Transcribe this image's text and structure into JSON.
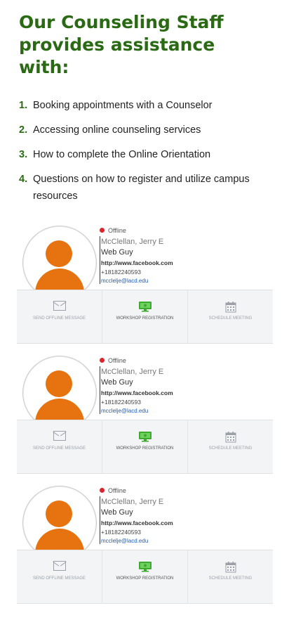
{
  "heading": {
    "line1": "Our Counseling Staff",
    "line2": "provides assistance",
    "line3": "with:"
  },
  "services": [
    {
      "number": "1.",
      "text": "Booking appointments with a Counselor"
    },
    {
      "number": "2.",
      "text": "Accessing online counseling services"
    },
    {
      "number": "3.",
      "text": "How to complete the Online Orientation"
    },
    {
      "number": "4.",
      "text": "Questions on how to register and utilize campus resources"
    }
  ],
  "colors": {
    "heading": "#2b6a14",
    "avatar": "#e6730f",
    "offline_dot": "#d8262b",
    "workshop_icon": "#3cab2d",
    "email_link": "#1b5eb5"
  },
  "cards": [
    {
      "status": "Offline",
      "name": "McClellan, Jerry E",
      "title": "Web Guy",
      "url": "http://www.facebook.com",
      "phone": "+18182240593",
      "email": "mcclelje@lacd.edu",
      "actions": {
        "message": "SEND OFFLINE MESSAGE",
        "workshop": "WORKSHOP REGISTRATION",
        "meeting": "SCHEDULE MEETING"
      }
    },
    {
      "status": "Offline",
      "name": "McClellan, Jerry E",
      "title": "Web Guy",
      "url": "http://www.facebook.com",
      "phone": "+18182240593",
      "email": "mcclelje@lacd.edu",
      "actions": {
        "message": "SEND OFFLINE MESSAGE",
        "workshop": "WORKSHOP REGISTRATION",
        "meeting": "SCHEDULE MEETING"
      }
    },
    {
      "status": "Offline",
      "name": "McClellan, Jerry E",
      "title": "Web Guy",
      "url": "http://www.facebook.com",
      "phone": "+18182240593",
      "email": "mcclelje@lacd.edu",
      "actions": {
        "message": "SEND OFFLINE MESSAGE",
        "workshop": "WORKSHOP REGISTRATION",
        "meeting": "SCHEDULE MEETING"
      }
    }
  ]
}
